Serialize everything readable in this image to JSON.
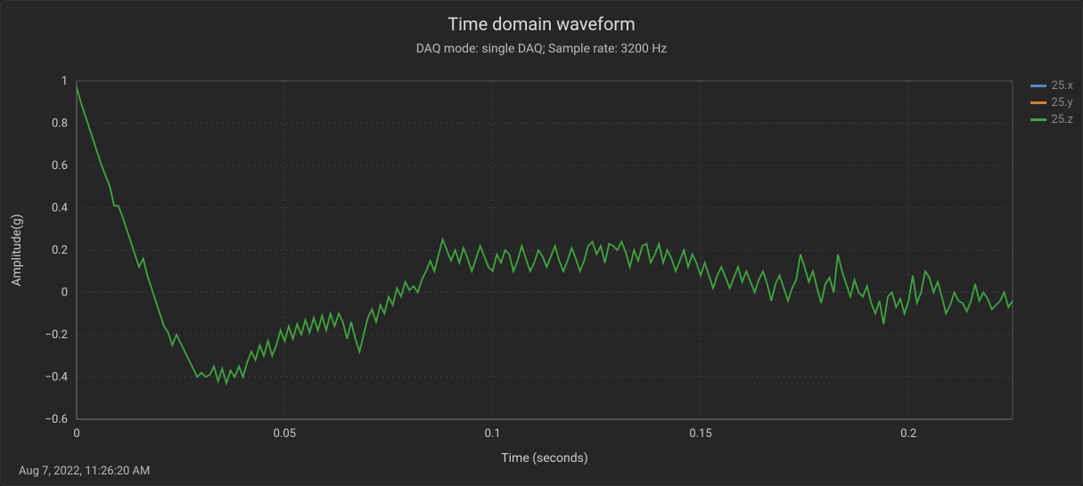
{
  "chart_data": {
    "type": "line",
    "title": "Time domain waveform",
    "subtitle": "DAQ mode: single DAQ; Sample rate: 3200 Hz",
    "xlabel": "Time (seconds)",
    "ylabel": "Amplitude(g)",
    "xlim": [
      0,
      0.225
    ],
    "ylim": [
      -0.6,
      1.0
    ],
    "xticks": [
      0,
      0.05,
      0.1,
      0.15,
      0.2
    ],
    "yticks": [
      -0.6,
      -0.4,
      -0.2,
      0,
      0.2,
      0.4,
      0.6,
      0.8,
      1.0
    ],
    "series": [
      {
        "name": "25.x",
        "color": "#4a8bc7",
        "x": [],
        "y": []
      },
      {
        "name": "25.y",
        "color": "#d87c3a",
        "x": [],
        "y": []
      },
      {
        "name": "25.z",
        "color": "#3fa63f",
        "x": [
          0,
          0.001,
          0.002,
          0.003,
          0.004,
          0.005,
          0.006,
          0.007,
          0.008,
          0.009,
          0.01,
          0.011,
          0.012,
          0.013,
          0.014,
          0.015,
          0.016,
          0.017,
          0.018,
          0.019,
          0.02,
          0.021,
          0.022,
          0.023,
          0.024,
          0.025,
          0.026,
          0.027,
          0.028,
          0.029,
          0.03,
          0.031,
          0.032,
          0.033,
          0.034,
          0.035,
          0.036,
          0.037,
          0.038,
          0.039,
          0.04,
          0.041,
          0.042,
          0.043,
          0.044,
          0.045,
          0.046,
          0.047,
          0.048,
          0.049,
          0.05,
          0.051,
          0.052,
          0.053,
          0.054,
          0.055,
          0.056,
          0.057,
          0.058,
          0.059,
          0.06,
          0.061,
          0.062,
          0.063,
          0.064,
          0.065,
          0.066,
          0.067,
          0.068,
          0.069,
          0.07,
          0.071,
          0.072,
          0.073,
          0.074,
          0.075,
          0.076,
          0.077,
          0.078,
          0.079,
          0.08,
          0.081,
          0.082,
          0.083,
          0.084,
          0.085,
          0.086,
          0.087,
          0.088,
          0.089,
          0.09,
          0.091,
          0.092,
          0.093,
          0.094,
          0.095,
          0.096,
          0.097,
          0.098,
          0.099,
          0.1,
          0.101,
          0.102,
          0.103,
          0.104,
          0.105,
          0.106,
          0.107,
          0.108,
          0.109,
          0.11,
          0.111,
          0.112,
          0.113,
          0.114,
          0.115,
          0.116,
          0.117,
          0.118,
          0.119,
          0.12,
          0.121,
          0.122,
          0.123,
          0.124,
          0.125,
          0.126,
          0.127,
          0.128,
          0.129,
          0.13,
          0.131,
          0.132,
          0.133,
          0.134,
          0.135,
          0.136,
          0.137,
          0.138,
          0.139,
          0.14,
          0.141,
          0.142,
          0.143,
          0.144,
          0.145,
          0.146,
          0.147,
          0.148,
          0.149,
          0.15,
          0.151,
          0.152,
          0.153,
          0.154,
          0.155,
          0.156,
          0.157,
          0.158,
          0.159,
          0.16,
          0.161,
          0.162,
          0.163,
          0.164,
          0.165,
          0.166,
          0.167,
          0.168,
          0.169,
          0.17,
          0.171,
          0.172,
          0.173,
          0.174,
          0.175,
          0.176,
          0.177,
          0.178,
          0.179,
          0.18,
          0.181,
          0.182,
          0.183,
          0.184,
          0.185,
          0.186,
          0.187,
          0.188,
          0.189,
          0.19,
          0.191,
          0.192,
          0.193,
          0.194,
          0.195,
          0.196,
          0.197,
          0.198,
          0.199,
          0.2,
          0.201,
          0.202,
          0.203,
          0.204,
          0.205,
          0.206,
          0.207,
          0.208,
          0.209,
          0.21,
          0.211,
          0.212,
          0.213,
          0.214,
          0.215,
          0.216,
          0.217,
          0.218,
          0.219,
          0.22,
          0.221,
          0.222,
          0.223,
          0.224,
          0.225
        ],
        "y": [
          0.97,
          0.9,
          0.84,
          0.78,
          0.72,
          0.66,
          0.6,
          0.55,
          0.5,
          0.41,
          0.41,
          0.36,
          0.3,
          0.24,
          0.18,
          0.12,
          0.16,
          0.08,
          0.02,
          -0.04,
          -0.1,
          -0.16,
          -0.19,
          -0.25,
          -0.2,
          -0.24,
          -0.28,
          -0.32,
          -0.36,
          -0.4,
          -0.38,
          -0.4,
          -0.39,
          -0.35,
          -0.42,
          -0.36,
          -0.43,
          -0.37,
          -0.4,
          -0.35,
          -0.4,
          -0.33,
          -0.28,
          -0.32,
          -0.25,
          -0.3,
          -0.23,
          -0.3,
          -0.25,
          -0.18,
          -0.23,
          -0.16,
          -0.22,
          -0.15,
          -0.2,
          -0.13,
          -0.19,
          -0.12,
          -0.18,
          -0.11,
          -0.18,
          -0.1,
          -0.16,
          -0.1,
          -0.14,
          -0.22,
          -0.14,
          -0.22,
          -0.28,
          -0.2,
          -0.12,
          -0.08,
          -0.14,
          -0.06,
          -0.1,
          -0.02,
          -0.06,
          0.02,
          -0.02,
          0.05,
          0.01,
          0.03,
          0.0,
          0.06,
          0.1,
          0.15,
          0.1,
          0.18,
          0.25,
          0.2,
          0.15,
          0.2,
          0.14,
          0.21,
          0.16,
          0.1,
          0.16,
          0.22,
          0.17,
          0.12,
          0.1,
          0.18,
          0.14,
          0.2,
          0.18,
          0.1,
          0.15,
          0.22,
          0.16,
          0.1,
          0.14,
          0.2,
          0.17,
          0.12,
          0.17,
          0.22,
          0.15,
          0.1,
          0.15,
          0.21,
          0.16,
          0.1,
          0.15,
          0.22,
          0.24,
          0.18,
          0.22,
          0.14,
          0.23,
          0.22,
          0.2,
          0.24,
          0.19,
          0.12,
          0.2,
          0.15,
          0.22,
          0.23,
          0.14,
          0.18,
          0.23,
          0.14,
          0.2,
          0.16,
          0.1,
          0.15,
          0.2,
          0.12,
          0.18,
          0.14,
          0.08,
          0.14,
          0.08,
          0.02,
          0.08,
          0.12,
          0.07,
          0.02,
          0.07,
          0.12,
          0.05,
          0.1,
          0.05,
          0.0,
          0.06,
          0.1,
          0.04,
          -0.04,
          0.04,
          0.08,
          0.02,
          -0.04,
          0.02,
          0.06,
          0.18,
          0.12,
          0.05,
          0.1,
          0.02,
          -0.05,
          0.04,
          0.07,
          0.0,
          0.18,
          0.1,
          0.04,
          -0.02,
          0.06,
          0.0,
          -0.02,
          0.03,
          -0.05,
          -0.1,
          -0.04,
          -0.15,
          -0.02,
          0.0,
          -0.07,
          -0.03,
          -0.1,
          -0.04,
          0.08,
          -0.05,
          0.0,
          0.1,
          0.07,
          0.0,
          0.05,
          -0.02,
          -0.1,
          -0.06,
          0.0,
          -0.04,
          -0.05,
          -0.09,
          -0.04,
          0.04,
          -0.04,
          0.0,
          -0.03,
          -0.08,
          -0.06,
          -0.04,
          0.0,
          -0.07,
          -0.04
        ]
      }
    ]
  },
  "timestamp": "Aug 7, 2022, 11:26:20 AM"
}
